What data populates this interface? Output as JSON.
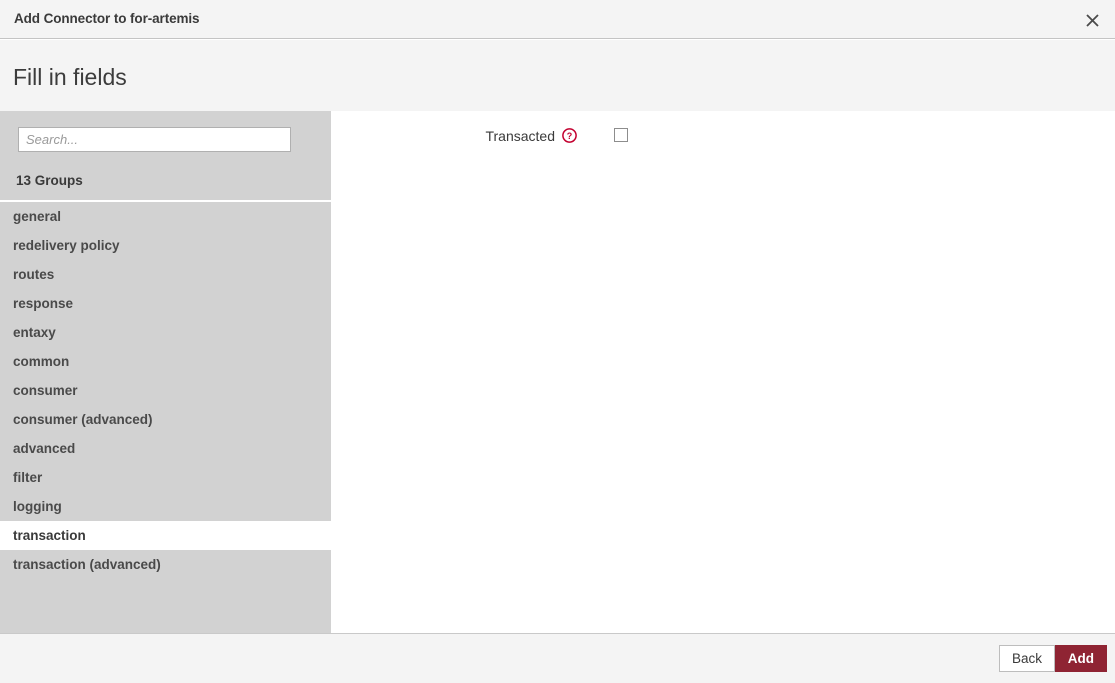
{
  "titlebar": {
    "title": "Add Connector to for-artemis",
    "close_icon": "close-icon"
  },
  "header": {
    "title": "Fill in fields"
  },
  "sidebar": {
    "search": {
      "placeholder": "Search...",
      "value": ""
    },
    "groups_count_label": "13 Groups",
    "selected_group": "transaction",
    "items": [
      {
        "label": "general",
        "selected": false
      },
      {
        "label": "redelivery policy",
        "selected": false
      },
      {
        "label": "routes",
        "selected": false
      },
      {
        "label": "response",
        "selected": false
      },
      {
        "label": "entaxy",
        "selected": false
      },
      {
        "label": "common",
        "selected": false
      },
      {
        "label": "consumer",
        "selected": false
      },
      {
        "label": "consumer (advanced)",
        "selected": false
      },
      {
        "label": "advanced",
        "selected": false
      },
      {
        "label": "filter",
        "selected": false
      },
      {
        "label": "logging",
        "selected": false
      },
      {
        "label": "transaction",
        "selected": true
      },
      {
        "label": "transaction (advanced)",
        "selected": false
      }
    ]
  },
  "content": {
    "fields": [
      {
        "label": "Transacted",
        "help_icon": "help-circle-icon",
        "type": "checkbox",
        "checked": false
      }
    ]
  },
  "footer": {
    "back_label": "Back",
    "add_label": "Add"
  },
  "colors": {
    "accent": "#8f2433",
    "help_icon": "#c3002f",
    "sidebar_bg": "#d2d2d2",
    "panel_bg": "#f4f4f4"
  }
}
